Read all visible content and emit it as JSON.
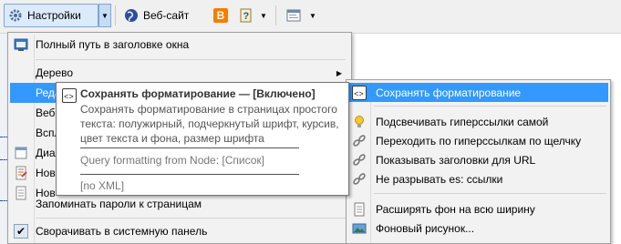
{
  "toolbar": {
    "settings_label": "Настройки",
    "website_label": "Веб-сайт"
  },
  "menu": {
    "items": [
      {
        "label": "Полный путь в заголовке окна"
      },
      {
        "label": "Дерево"
      },
      {
        "label": "Реда"
      },
      {
        "label": "Веб с"
      },
      {
        "label": "Вспл"
      },
      {
        "label": "Диал"
      },
      {
        "label": "Нов"
      },
      {
        "label": "Нов"
      },
      {
        "label": "Запоминать пароли к страницам"
      },
      {
        "label": "Сворачивать в системную панель"
      }
    ]
  },
  "submenu": {
    "items": [
      {
        "label": "Сохранять форматирование"
      },
      {
        "label": "Подсвечивать гиперссылки самой"
      },
      {
        "label": "Переходить по гиперссылкам по щелчку"
      },
      {
        "label": "Показывать заголовки для URL"
      },
      {
        "label": "Не разрывать es: ссылки"
      },
      {
        "label": "Расширять фон на всю ширину"
      },
      {
        "label": "Фоновый рисунок..."
      }
    ]
  },
  "tooltip": {
    "title": "Сохранять форматирование — [Включено]",
    "description": "Сохранять форматирование в страницах простого текста: полужирный, подчеркнутый шрифт, курсив, цвет текста и фона, размер шрифта",
    "query": "Query formatting from Node: [Список]",
    "xml": "[no XML]"
  },
  "colors": {
    "highlight": "#3399ff",
    "menu_bg": "#f2f2f2"
  }
}
